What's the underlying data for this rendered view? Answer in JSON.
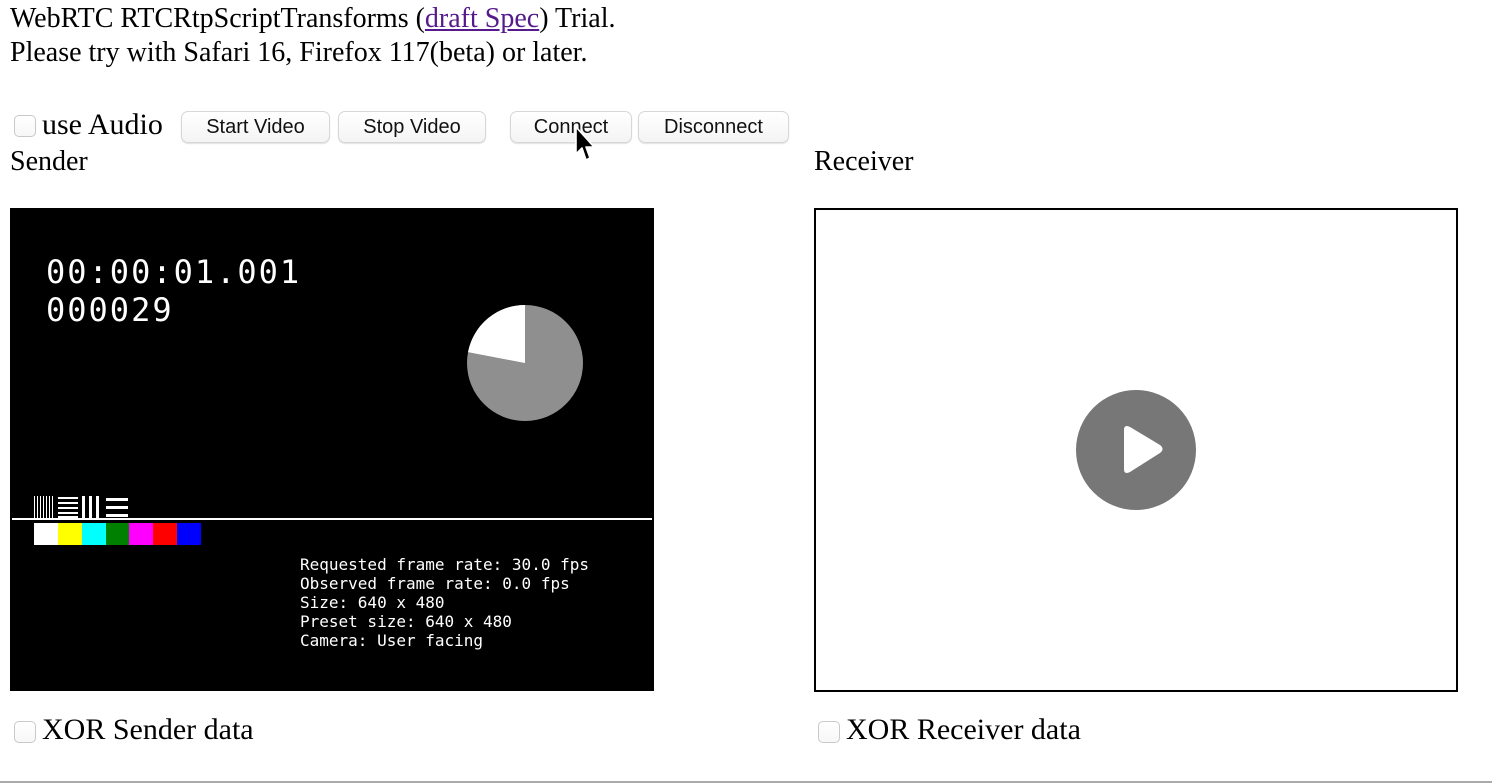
{
  "intro": {
    "title_prefix": "WebRTC RTCRtpScriptTransforms (",
    "spec_link": "draft Spec",
    "title_suffix": ") Trial.",
    "note": "Please try with Safari 16, Firefox 117(beta) or later."
  },
  "controls": {
    "audio_label": "use Audio",
    "audio_checked": false,
    "start_video": "Start Video",
    "stop_video": "Stop Video",
    "connect": "Connect",
    "disconnect": "Disconnect"
  },
  "sender": {
    "heading": "Sender",
    "timecode": "00:00:01.001",
    "frame_count": "000029",
    "progress_pie_fraction": 0.78,
    "color_bar_colors": [
      "#ffffff",
      "#ffff00",
      "#00ffff",
      "#008000",
      "#ff00ff",
      "#ff0000",
      "#0000ff"
    ],
    "stats": [
      "Requested frame rate: 30.0 fps",
      "Observed frame rate: 0.0 fps",
      "Size: 640 x 480",
      "Preset size: 640 x 480",
      "Camera: User facing"
    ],
    "xor_label": "XOR Sender data",
    "xor_checked": false
  },
  "receiver": {
    "heading": "Receiver",
    "play_icon": "play-icon",
    "xor_label": "XOR Receiver data",
    "xor_checked": false
  },
  "colors": {
    "link": "#551a8b",
    "sender_video_background": "#000000",
    "receiver_play_button": "#777777"
  },
  "cursor_icon": "mouse-pointer-icon"
}
